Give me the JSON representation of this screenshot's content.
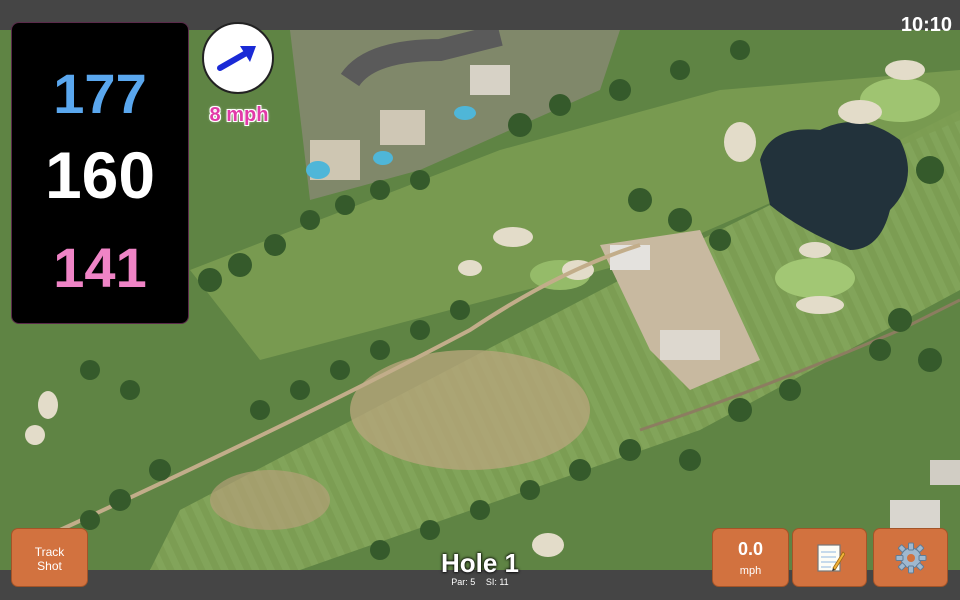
{
  "status": {
    "time": "10:10"
  },
  "yardages": {
    "back": "177",
    "middle": "160",
    "front": "141"
  },
  "wind": {
    "speed_label": "8 mph",
    "direction_icon": "arrow-icon"
  },
  "hole": {
    "title": "Hole 1",
    "par_label": "Par: 5",
    "si_label": "SI: 11"
  },
  "buttons": {
    "track_shot": "Track\nShot",
    "speed_value": "0.0",
    "speed_unit": "mph",
    "notes_icon": "notepad-icon",
    "settings_icon": "gear-icon"
  },
  "colors": {
    "back": "#5aa7ee",
    "middle": "#ffffff",
    "front": "#ef84c6",
    "button": "#d2723f",
    "wind_text": "#e23aa8"
  }
}
